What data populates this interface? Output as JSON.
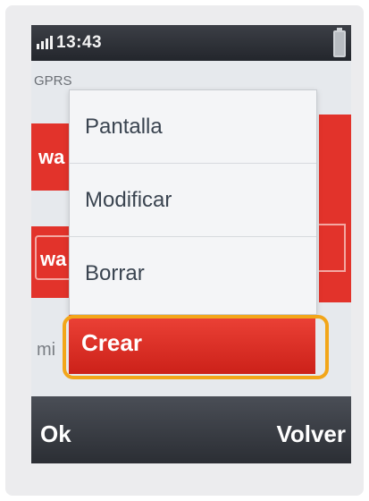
{
  "status_bar": {
    "time": "13:43"
  },
  "background": {
    "network_label": "GPRS",
    "item_1_text": "wa",
    "item_2_text": "wa",
    "item_3_text": "mi"
  },
  "menu": {
    "items": [
      {
        "label": "Pantalla"
      },
      {
        "label": "Modificar"
      },
      {
        "label": "Borrar"
      }
    ],
    "selected_item": {
      "label": "Crear"
    },
    "highlight_color": "#f2a61a",
    "selected_color": "#e2332b"
  },
  "softkeys": {
    "left": "Ok",
    "right": "Volver"
  }
}
